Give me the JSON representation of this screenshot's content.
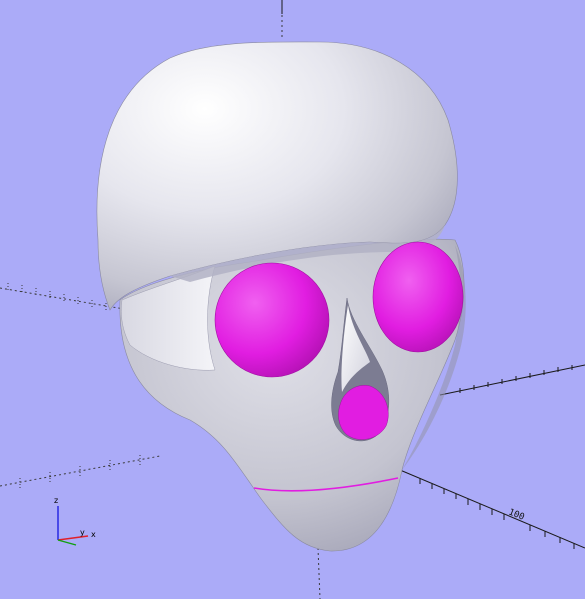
{
  "viewport": {
    "background": "#ababf8",
    "model_name": "skull",
    "model_color": "#e8e8f0",
    "cutout_color": "#e11de1",
    "axes": {
      "x_axis_color": "#1a1a1a",
      "tick_labels": [
        "100"
      ]
    },
    "gizmo": {
      "labels": [
        "z",
        "y",
        "x"
      ],
      "x_color": "#e0202b",
      "y_color": "#10a010",
      "z_color": "#2020e0"
    }
  }
}
